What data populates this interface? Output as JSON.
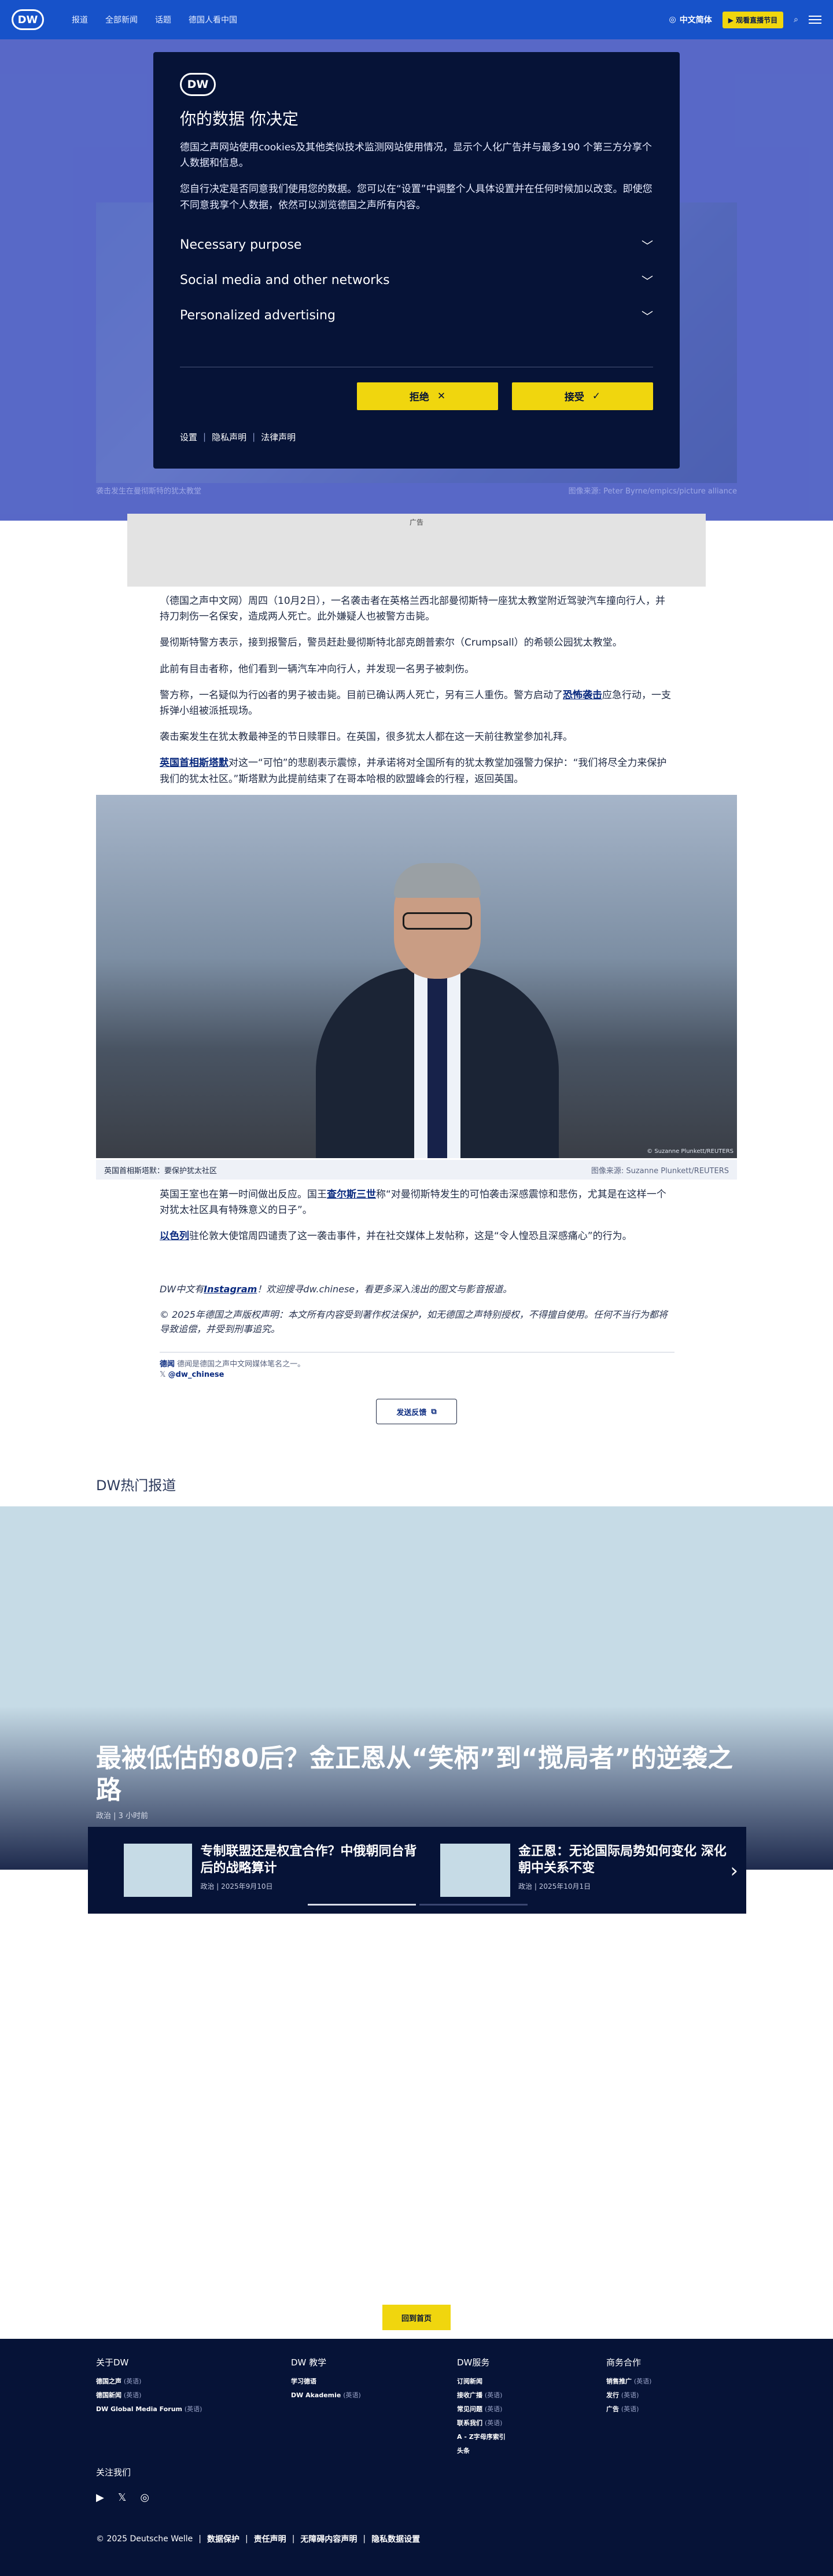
{
  "header": {
    "logo": "DW",
    "nav": [
      "报道",
      "全部新闻",
      "话题",
      "德国人看中国"
    ],
    "language": "中文简体",
    "live": "▶ 观看直播节目"
  },
  "hero": {
    "caption": "袭击发生在曼彻斯特的犹太教堂",
    "credit": "图像来源: Peter Byrne/empics/picture alliance"
  },
  "consent": {
    "logo": "DW",
    "title": "你的数据 你决定",
    "p1": "德国之声网站使用cookies及其他类似技术监测网站使用情况，显示个人化广告并与最多190 个第三方分享个人数据和信息。",
    "p2": "您自行决定是否同意我们使用您的数据。您可以在“设置”中调整个人具体设置并在任何时候加以改变。即使您不同意我享个人数据，依然可以浏览德国之声所有内容。",
    "items": [
      "Necessary purpose",
      "Social media and other networks",
      "Personalized advertising"
    ],
    "reject": "拒绝",
    "accept": "接受",
    "links": [
      "设置",
      "隐私声明",
      "法律声明"
    ]
  },
  "ad_label": "广告",
  "article": {
    "p1": "（德国之声中文网）周四（10月2日），一名袭击者在英格兰西北部曼彻斯特一座犹太教堂附近驾驶汽车撞向行人，并持刀刺伤一名保安，造成两人死亡。此外嫌疑人也被警方击毙。",
    "p2": "曼彻斯特警方表示，接到报警后，警员赶赴曼彻斯特北部克朗普索尔（Crumpsall）的希顿公园犹太教堂。",
    "p3": "此前有目击者称，他们看到一辆汽车冲向行人，并发现一名男子被刺伤。",
    "p4_a": "警方称，一名疑似为行凶者的男子被击毙。目前已确认两人死亡，另有三人重伤。警方启动了",
    "p4_link": "恐怖袭击",
    "p4_b": "应急行动，一支拆弹小组被派抵现场。",
    "p5": "袭击案发生在犹太教最神圣的节日赎罪日。在英国，很多犹太人都在这一天前往教堂参加礼拜。",
    "p6_link": "英国首相斯塔默",
    "p6_b": "对这一“可怕”的悲剧表示震惊，并承诺将对全国所有的犹太教堂加强警力保护：“我们将尽全力来保护我们的犹太社区。”斯塔默为此提前结束了在哥本哈根的欧盟峰会的行程，返回英国。",
    "photo_caption": "英国首相斯塔默：要保护犹太社区",
    "photo_credit": "图像来源: Suzanne Plunkett/REUTERS",
    "photo_credit_inner": "© Suzanne Plunkett/REUTERS",
    "p7_a": "英国王室也在第一时间做出反应。国王",
    "p7_link": "查尔斯三世",
    "p7_b": "称“对曼彻斯特发生的可怕袭击深感震惊和悲伤，尤其是在这样一个对犹太社区具有特殊意义的日子”。",
    "p8_link": "以色列",
    "p8_b": "驻伦敦大使馆周四谴责了这一袭击事件，并在社交媒体上发帖称，这是“令人惶恐且深感痛心”的行为。",
    "note1_a": "DW中文有",
    "note1_link": "Instagram",
    "note1_b": "！欢迎搜寻dw.chinese，看更多深入浅出的图文与影音报道。",
    "note2": "© 2025年德国之声版权声明：本文所有内容受到著作权法保护，如无德国之声特别授权，不得擅自使用。任何不当行为都将导致追偿，并受到刑事追究。",
    "tag_label": "德闻",
    "tag_text": "德闻是德国之声中文网媒体笔名之一。",
    "tag_x": "@dw_chinese",
    "feedback": "发送反馈"
  },
  "popular": {
    "title": "DW热门报道",
    "feature_title": "最被低估的80后？金正恩从“笑柄”到“搅局者”的逆袭之路",
    "feature_meta": "政治 | 3 小时前",
    "cards": [
      {
        "title": "专制联盟还是权宜合作？中俄朝同台背后的战略算计",
        "meta": "政治 | 2025年9月10日"
      },
      {
        "title": "金正恩：无论国际局势如何变化 深化朝中关系不变",
        "meta": "政治 | 2025年10月1日"
      }
    ]
  },
  "back_to_top": "回到首页",
  "footer": {
    "cols": [
      {
        "title": "关于DW",
        "items": [
          [
            "德国之声",
            "(英语)"
          ],
          [
            "德国新闻",
            "(英语)"
          ],
          [
            "DW Global Media Forum",
            "(英语)"
          ]
        ]
      },
      {
        "title": "DW 教学",
        "items": [
          [
            "学习德语",
            ""
          ],
          [
            "DW Akademie",
            "(英语)"
          ]
        ]
      },
      {
        "title": "DW服务",
        "items": [
          [
            "订阅新闻",
            ""
          ],
          [
            "接收广播",
            "(英语)"
          ],
          [
            "常见问题",
            "(英语)"
          ],
          [
            "联系我们",
            "(英语)"
          ],
          [
            "A - Z字母序索引",
            ""
          ],
          [
            "头条",
            ""
          ]
        ]
      },
      {
        "title": "商务合作",
        "items": [
          [
            "销售推广",
            "(英语)"
          ],
          [
            "发行",
            "(英语)"
          ],
          [
            "广告",
            "(英语)"
          ]
        ]
      }
    ],
    "follow": "关注我们",
    "copyright": "© 2025 Deutsche Welle",
    "links": [
      "数据保护",
      "责任声明",
      "无障碍内容声明",
      "隐私数据设置"
    ]
  }
}
